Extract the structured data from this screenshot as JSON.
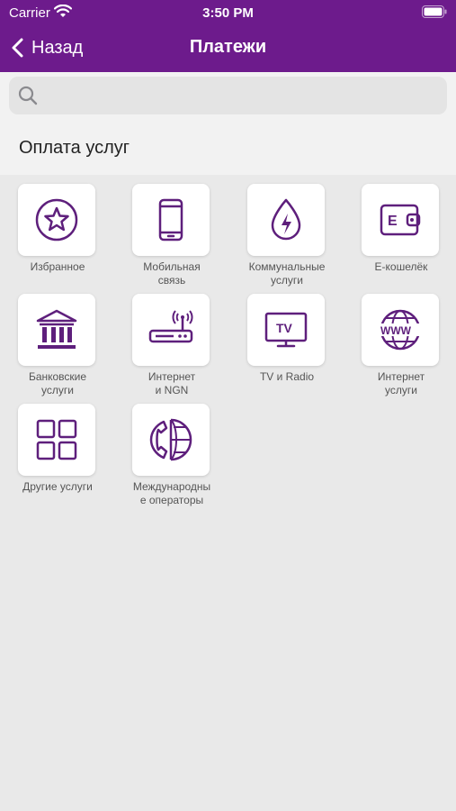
{
  "status_bar": {
    "carrier": "Carrier",
    "time": "3:50 PM"
  },
  "nav": {
    "back_label": "Назад",
    "title": "Платежи"
  },
  "search": {
    "placeholder": ""
  },
  "section": {
    "title": "Оплата услуг"
  },
  "theme": {
    "accent": "#6d1b8c",
    "icon_color": "#5e1f7c",
    "background": "#e9e9e9"
  },
  "categories": [
    {
      "label": "Избранное",
      "icon": "star-icon"
    },
    {
      "label": "Мобильная\nсвязь",
      "icon": "smartphone-icon"
    },
    {
      "label": "Коммунальные\nуслуги",
      "icon": "utility-drop-icon"
    },
    {
      "label": "E-кошелёк",
      "icon": "wallet-icon"
    },
    {
      "label": "Банковские\nуслуги",
      "icon": "bank-icon"
    },
    {
      "label": "Интернет\nи NGN",
      "icon": "router-icon"
    },
    {
      "label": "TV и Radio",
      "icon": "tv-icon"
    },
    {
      "label": "Интернет\nуслуги",
      "icon": "www-globe-icon"
    },
    {
      "label": "Другие услуги",
      "icon": "grid-icon"
    },
    {
      "label": "Международны\nе операторы",
      "icon": "phone-globe-icon"
    }
  ]
}
